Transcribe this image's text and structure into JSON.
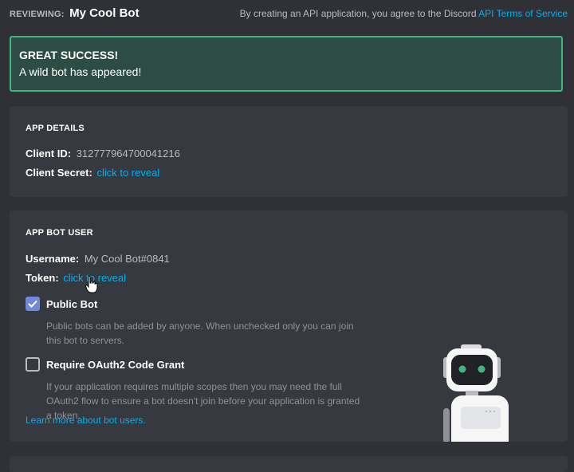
{
  "header": {
    "reviewing_label": "REVIEWING:",
    "app_name": "My Cool Bot",
    "tos_prefix": "By creating an API application, you agree to the Discord",
    "tos_link": "API Terms of Service"
  },
  "alert": {
    "title": "GREAT SUCCESS!",
    "message": "A wild bot has appeared!"
  },
  "app_details": {
    "heading": "APP DETAILS",
    "client_id_label": "Client ID:",
    "client_id_value": "312777964700041216",
    "client_secret_label": "Client Secret:",
    "client_secret_link": "click to reveal"
  },
  "app_bot_user": {
    "heading": "APP BOT USER",
    "username_label": "Username:",
    "username_value": "My Cool Bot#0841",
    "token_label": "Token:",
    "token_link": "click to reveal",
    "public_bot": {
      "label": "Public Bot",
      "checked": true,
      "description": "Public bots can be added by anyone. When unchecked only you can join this bot to servers."
    },
    "oauth2_grant": {
      "label": "Require OAuth2 Code Grant",
      "checked": false,
      "description": "If your application requires multiple scopes then you may need the full OAuth2 flow to ensure a bot doesn't join before your application is granted a token."
    },
    "learn_more_link": "Learn more about bot users."
  },
  "colors": {
    "accent_link": "#00b0f4",
    "success_border": "#43b581",
    "checkbox_checked": "#7289da"
  },
  "icons": [
    "checkmark-icon",
    "hand-cursor-icon",
    "robot-illustration"
  ]
}
